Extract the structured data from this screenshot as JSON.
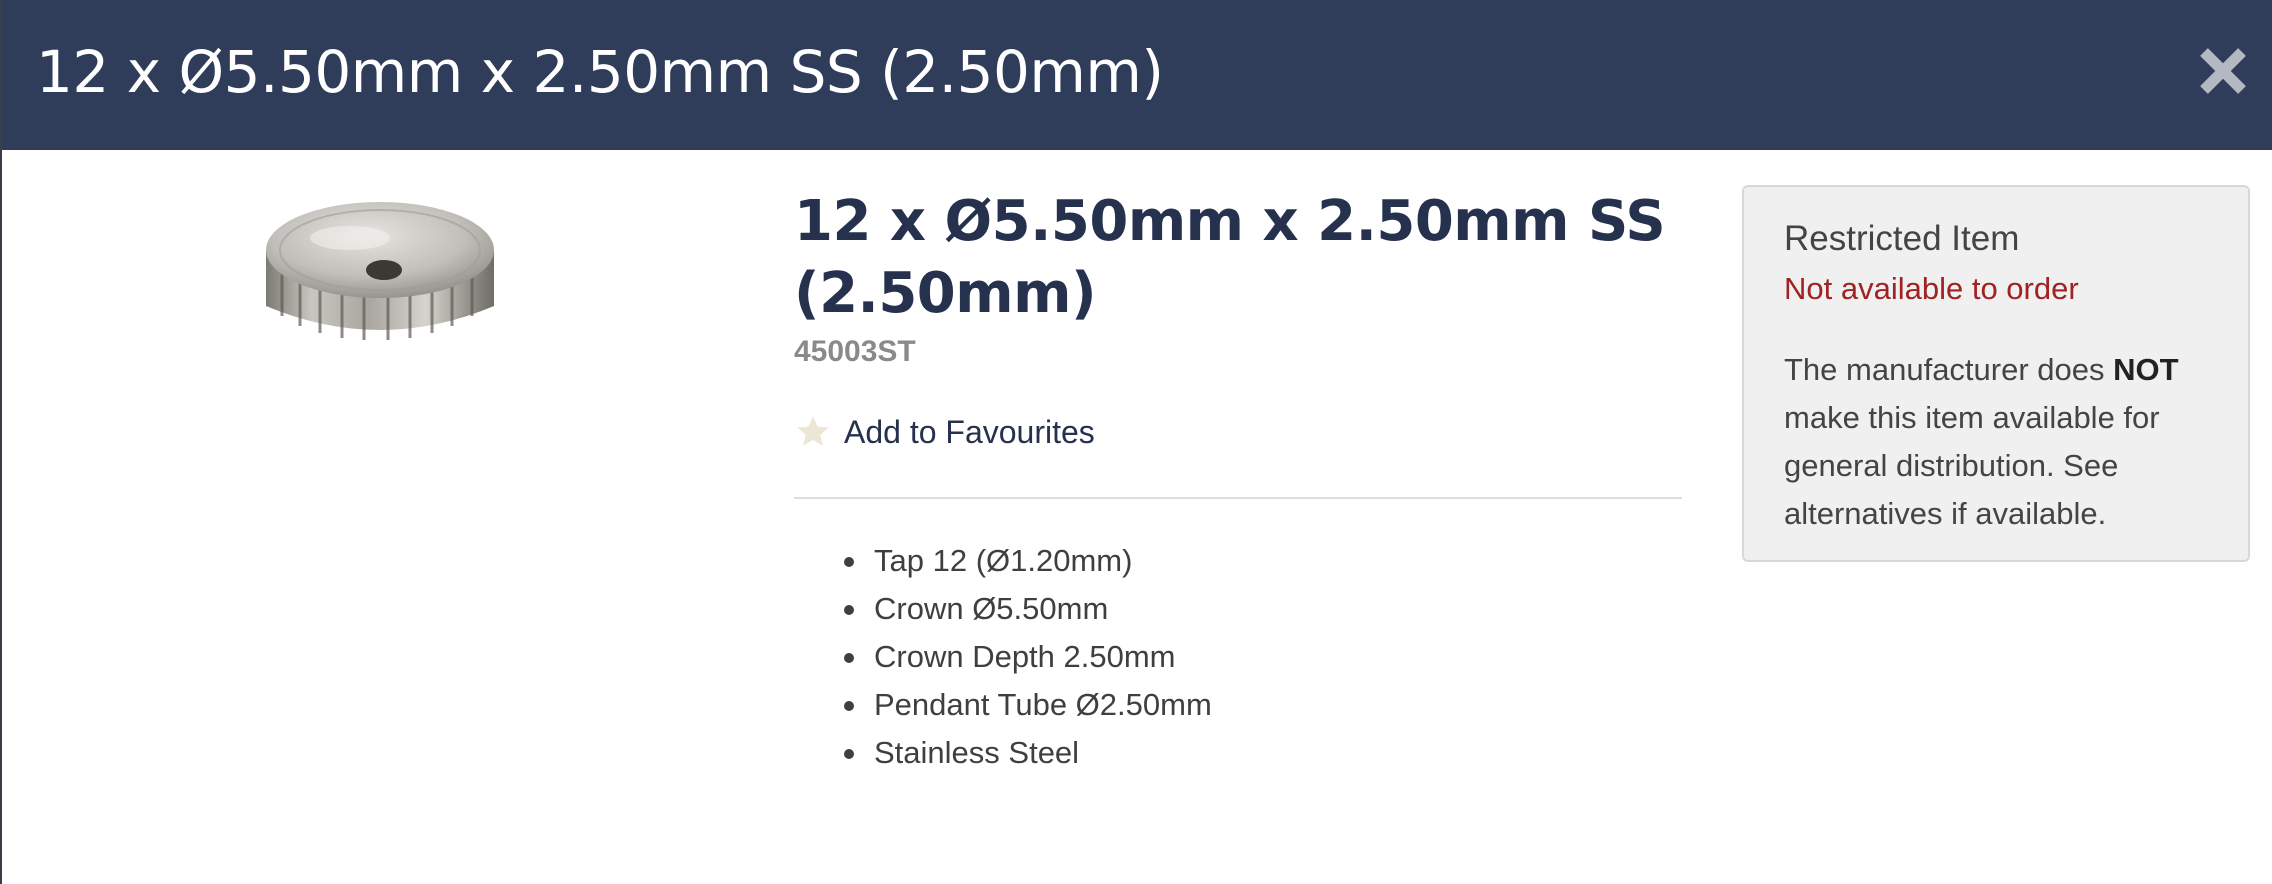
{
  "modal": {
    "title": "12 x Ø5.50mm x 2.50mm SS (2.50mm)",
    "close_icon": "close-icon",
    "header_color": "#2f3d5b"
  },
  "product": {
    "image_icon": "watch-crown-image",
    "title": "12 x Ø5.50mm x 2.50mm SS (2.50mm)",
    "sku": "45003ST",
    "favourite": {
      "icon": "star-icon",
      "label": "Add to Favourites"
    },
    "specs": [
      "Tap 12 (Ø1.20mm)",
      "Crown Ø5.50mm",
      "Crown Depth 2.50mm",
      "Pendant Tube Ø2.50mm",
      "Stainless Steel"
    ]
  },
  "restriction": {
    "title": "Restricted Item",
    "status": "Not available to order",
    "status_color": "#a12222",
    "description_before": "The manufacturer does ",
    "description_emphasis": "NOT",
    "description_after": " make this item available for general distribution. See alternatives if available."
  }
}
